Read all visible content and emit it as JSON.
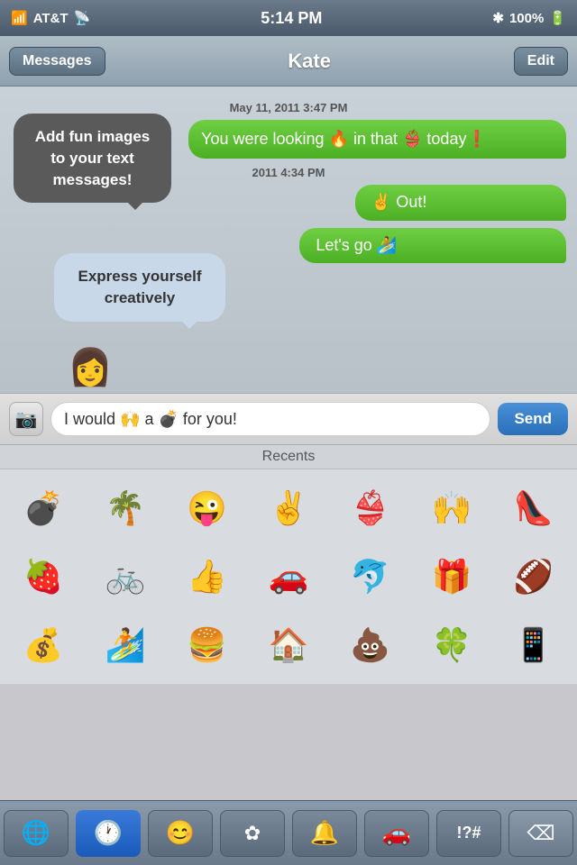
{
  "statusBar": {
    "carrier": "AT&T",
    "time": "5:14 PM",
    "batteryPercent": "100%"
  },
  "navBar": {
    "backLabel": "Messages",
    "title": "Kate",
    "editLabel": "Edit"
  },
  "messages": [
    {
      "type": "date",
      "text": "May 11, 2011 3:47 PM"
    },
    {
      "type": "sent",
      "text": "You were looking 🔥 in that 👙 today❗"
    },
    {
      "type": "date",
      "text": "2011 4:34 PM"
    },
    {
      "type": "sent",
      "text": "✌️ Out!"
    },
    {
      "type": "sent",
      "text": "Let's go 🏄"
    }
  ],
  "speechBubble1": {
    "text": "Add fun images to your text messages!"
  },
  "speechBubble2": {
    "text": "Express yourself creatively"
  },
  "inputBar": {
    "cameraIcon": "📷",
    "inputText": "I would 🙌 a 💣 for you!",
    "sendLabel": "Send"
  },
  "recents": {
    "label": "Recents"
  },
  "emojiRows": [
    [
      "💣",
      "🌴",
      "😜",
      "✌️",
      "👙",
      "🙌",
      "👠"
    ],
    [
      "🍓",
      "🚲",
      "👍",
      "🚗",
      "🐬",
      "🎁",
      "🏈"
    ],
    [
      "💰",
      "🏄",
      "🍔",
      "🏠",
      "💩",
      "🍀",
      "📱"
    ]
  ],
  "keyboardBar": {
    "buttons": [
      {
        "icon": "🌐",
        "label": "globe",
        "active": false
      },
      {
        "icon": "🕐",
        "label": "clock",
        "active": true
      },
      {
        "icon": "😊",
        "label": "smiley",
        "active": false
      },
      {
        "icon": "✿",
        "label": "flower",
        "active": false
      },
      {
        "icon": "🔔",
        "label": "bell",
        "active": false
      },
      {
        "icon": "🚗",
        "label": "car",
        "active": false
      },
      {
        "icon": "!?#",
        "label": "symbols",
        "active": false
      },
      {
        "icon": "⌫",
        "label": "delete",
        "active": false
      }
    ]
  }
}
